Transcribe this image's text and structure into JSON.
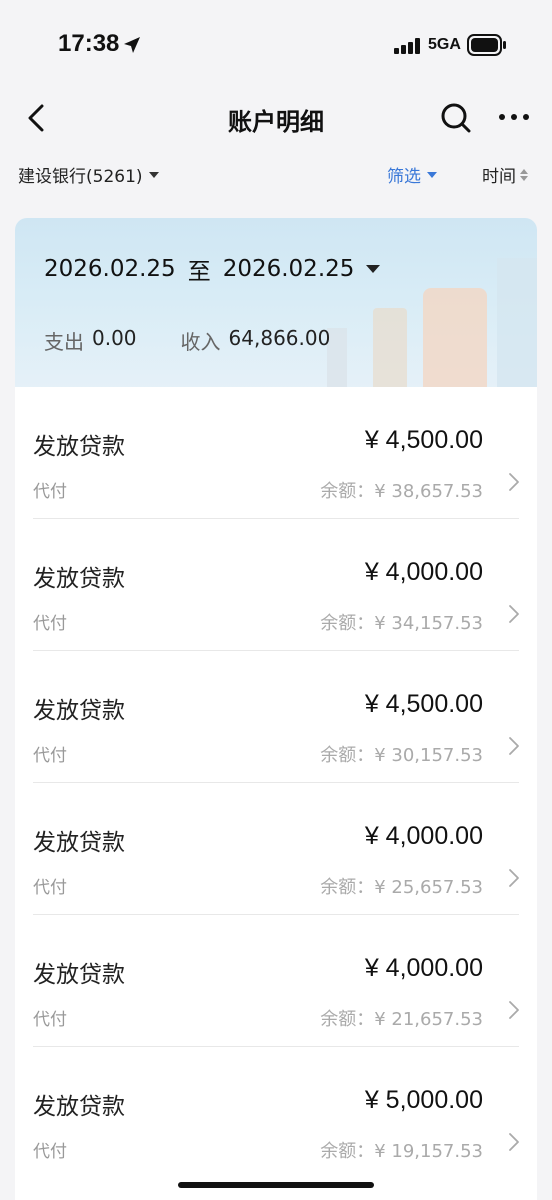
{
  "status": {
    "time": "17:38",
    "network": "5GA"
  },
  "nav": {
    "title": "账户明细"
  },
  "filter": {
    "account": "建设银行(5261)",
    "filter_label": "筛选",
    "sort_label": "时间"
  },
  "summary": {
    "date_start": "2026.02.25",
    "date_sep": "至",
    "date_end": "2026.02.25",
    "expense_label": "支出",
    "expense_value": "0.00",
    "income_label": "收入",
    "income_value": "64,866.00"
  },
  "transactions": [
    {
      "title": "发放贷款",
      "amount": "¥ 4,500.00",
      "subtitle": "代付",
      "balance": "余额：¥ 38,657.53"
    },
    {
      "title": "发放贷款",
      "amount": "¥ 4,000.00",
      "subtitle": "代付",
      "balance": "余额：¥ 34,157.53"
    },
    {
      "title": "发放贷款",
      "amount": "¥ 4,500.00",
      "subtitle": "代付",
      "balance": "余额：¥ 30,157.53"
    },
    {
      "title": "发放贷款",
      "amount": "¥ 4,000.00",
      "subtitle": "代付",
      "balance": "余额：¥ 25,657.53"
    },
    {
      "title": "发放贷款",
      "amount": "¥ 4,000.00",
      "subtitle": "代付",
      "balance": "余额：¥ 21,657.53"
    },
    {
      "title": "发放贷款",
      "amount": "¥ 5,000.00",
      "subtitle": "代付",
      "balance": "余额：¥ 19,157.53"
    }
  ],
  "colors": {
    "accent": "#3a78d8",
    "background": "#f4f4f6"
  },
  "icons": [
    "back-icon",
    "search-icon",
    "more-icon",
    "chevron-right-icon",
    "location-arrow-icon",
    "signal-icon",
    "battery-icon"
  ]
}
